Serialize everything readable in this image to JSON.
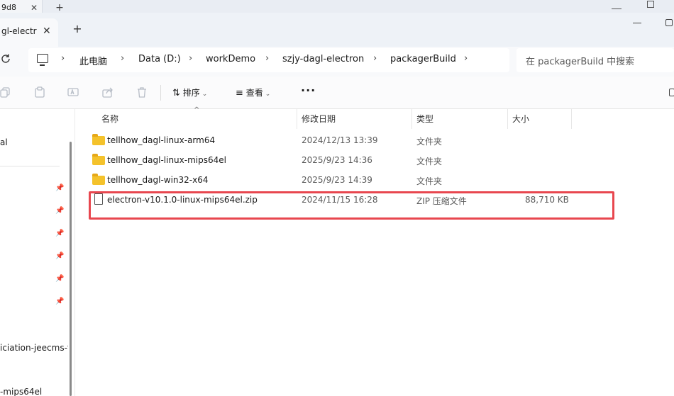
{
  "back_window": {
    "tab_fragment": "9d8"
  },
  "tab": {
    "label": "gl-electr",
    "close": "✕"
  },
  "new_tab": "+",
  "address": {
    "crumbs": [
      "此电脑",
      "Data (D:)",
      "workDemo",
      "szjy-dagl-electron",
      "packagerBuild"
    ],
    "search_placeholder": "在 packagerBuild 中搜索"
  },
  "toolbar": {
    "sort_label": "排序",
    "view_label": "查看",
    "more_label": "···"
  },
  "sidebar": {
    "top_item": "al",
    "pinned_count": 6,
    "item_jeecms": "iciation-jeecms-fi",
    "item_mips": "-mips64el"
  },
  "columns": {
    "name": "名称",
    "modified": "修改日期",
    "type": "类型",
    "size": "大小"
  },
  "files": [
    {
      "icon": "folder-icon",
      "name": "tellhow_dagl-linux-arm64",
      "modified": "2024/12/13 13:39",
      "type": "文件夹",
      "size": ""
    },
    {
      "icon": "folder-icon",
      "name": "tellhow_dagl-linux-mips64el",
      "modified": "2025/9/23 14:36",
      "type": "文件夹",
      "size": ""
    },
    {
      "icon": "folder-icon",
      "name": "tellhow_dagl-win32-x64",
      "modified": "2025/9/23 14:39",
      "type": "文件夹",
      "size": ""
    },
    {
      "icon": "file-icon",
      "name": "electron-v10.1.0-linux-mips64el.zip",
      "modified": "2024/11/15 16:28",
      "type": "ZIP 压缩文件",
      "size": "88,710 KB"
    }
  ],
  "colors": {
    "highlight_border": "#e8474f",
    "folder": "#f4c22b"
  }
}
